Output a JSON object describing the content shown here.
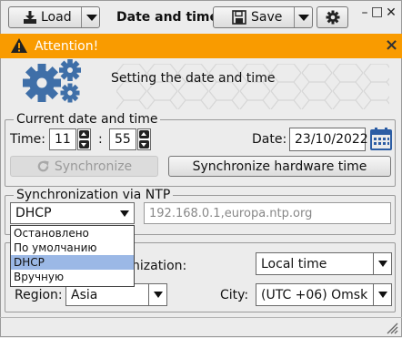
{
  "toolbar": {
    "load_label": "Load",
    "title": "Date and time",
    "save_label": "Save"
  },
  "window_controls": {
    "minimize": "–",
    "restore": "□",
    "close": "✕"
  },
  "attention": {
    "text": "Attention!",
    "close": "×",
    "color": "#f99b00"
  },
  "header": {
    "text": "Setting the date and time"
  },
  "current": {
    "legend": "Current date and time",
    "time_label": "Time:",
    "hours": "11",
    "separator": ":",
    "minutes": "55",
    "date_label": "Date:",
    "date": "23/10/2022",
    "sync_button": "Synchronize",
    "sync_hw_button": "Synchronize hardware time"
  },
  "ntp": {
    "legend": "Synchronization via NTP",
    "mode": "DHCP",
    "servers": "192.168.0.1,europa.ntp.org",
    "options": [
      "Остановлено",
      "По умолчанию",
      "DHCP",
      "Вручную"
    ],
    "selected_index": 2
  },
  "tz": {
    "sync_label_partial": "nization:",
    "time_mode": "Local time",
    "region_label": "Region:",
    "region": "Asia",
    "city_label": "City:",
    "city": "(UTC +06) Omsk"
  }
}
